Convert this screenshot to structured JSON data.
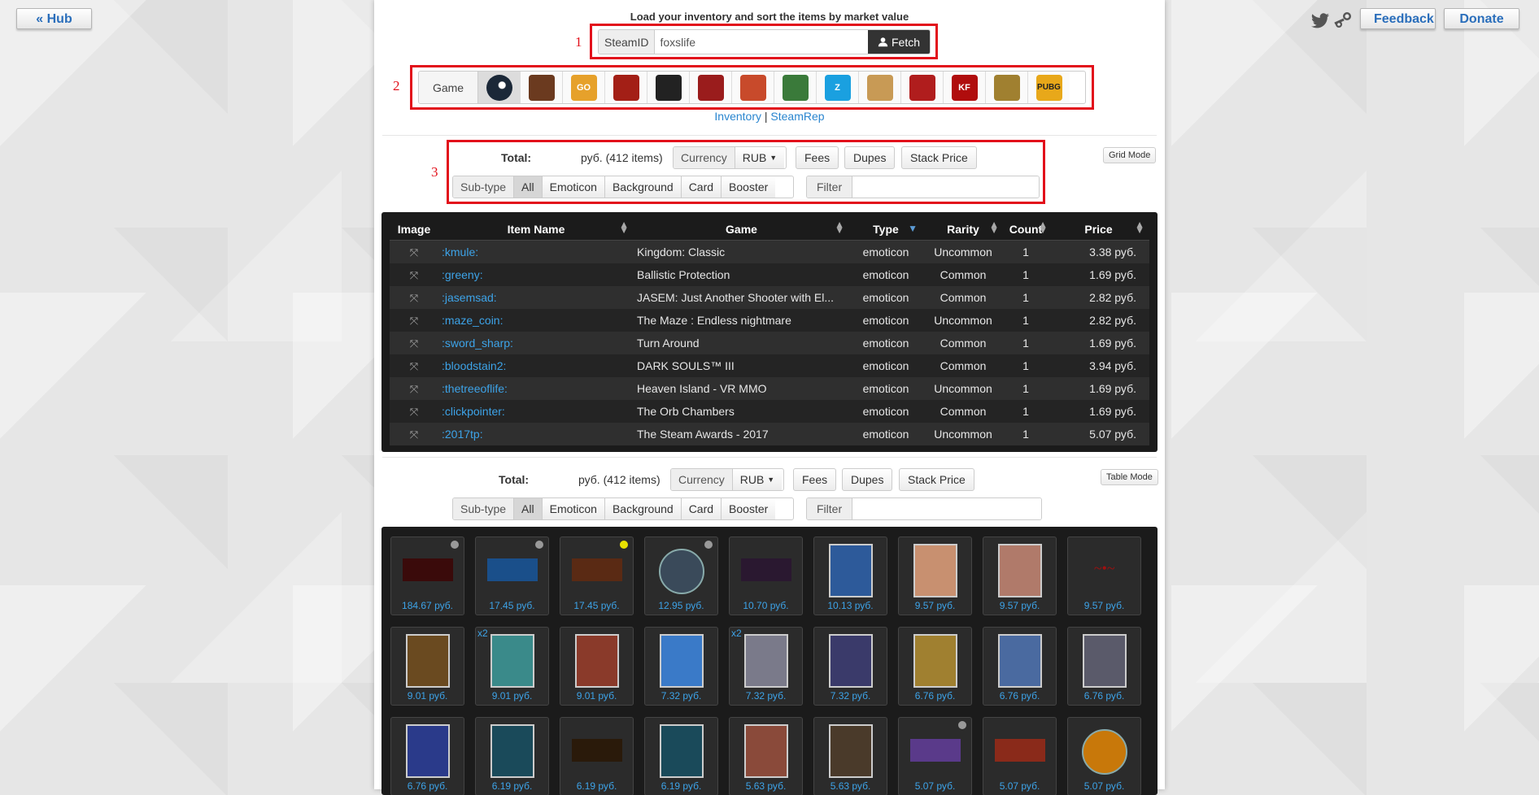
{
  "header": {
    "hub_label": "« Hub",
    "feedback_label": "Feedback",
    "donate_label": "Donate"
  },
  "load": {
    "title": "Load your inventory and sort the items by market value",
    "steamid_label": "SteamID",
    "steamid_value": "foxslife",
    "fetch_label": "Fetch"
  },
  "annotations": [
    "1",
    "2",
    "3"
  ],
  "games": {
    "label": "Game",
    "items": [
      {
        "icon": "steam-icon",
        "color": "#1b2838",
        "text": "",
        "active": true
      },
      {
        "icon": "tf2-icon",
        "color": "#6b3a1f",
        "text": ""
      },
      {
        "icon": "csgo-icon",
        "color": "#e6a12b",
        "text": "GO"
      },
      {
        "icon": "dota2-icon",
        "color": "#a31f16",
        "text": ""
      },
      {
        "icon": "h1z1-icon",
        "color": "#222222",
        "text": ""
      },
      {
        "icon": "payday2-icon",
        "color": "#9a1c1c",
        "text": ""
      },
      {
        "icon": "rust-icon",
        "color": "#c84a2b",
        "text": ""
      },
      {
        "icon": "unturned-icon",
        "color": "#3a7a3a",
        "text": ""
      },
      {
        "icon": "dead-island-icon",
        "color": "#1aa0e0",
        "text": "Z"
      },
      {
        "icon": "bad-rats-icon",
        "color": "#c89a55",
        "text": ""
      },
      {
        "icon": "killing-floor-icon",
        "color": "#b01d1d",
        "text": ""
      },
      {
        "icon": "kf2-icon",
        "color": "#b00d0d",
        "text": "KF"
      },
      {
        "icon": "dota-underlords-icon",
        "color": "#a08030",
        "text": ""
      },
      {
        "icon": "pubg-icon",
        "color": "#e8a81a",
        "text": "PUBG"
      }
    ]
  },
  "links": {
    "inventory": "Inventory",
    "separator": "|",
    "steamrep": "SteamRep"
  },
  "toolbar": {
    "total_label": "Total:",
    "total_value": "руб. (412 items)",
    "currency_label": "Currency",
    "currency_value": "RUB",
    "fees_label": "Fees",
    "dupes_label": "Dupes",
    "stack_price_label": "Stack Price",
    "grid_mode_label": "Grid Mode",
    "table_mode_label": "Table Mode",
    "subtype_label": "Sub-type",
    "subtypes": [
      "All",
      "Emoticon",
      "Background",
      "Card",
      "Booster"
    ],
    "filter_label": "Filter"
  },
  "table": {
    "columns": [
      "Image",
      "Item Name",
      "Game",
      "Type",
      "Rarity",
      "Count",
      "Price"
    ],
    "rows": [
      {
        "name": ":kmule:",
        "game": "Kingdom: Classic",
        "type": "emoticon",
        "rarity": "Uncommon",
        "count": "1",
        "price": "3.38 руб."
      },
      {
        "name": ":greeny:",
        "game": "Ballistic Protection",
        "type": "emoticon",
        "rarity": "Common",
        "count": "1",
        "price": "1.69 руб."
      },
      {
        "name": ":jasemsad:",
        "game": "JASEM: Just Another Shooter with El...",
        "type": "emoticon",
        "rarity": "Common",
        "count": "1",
        "price": "2.82 руб."
      },
      {
        "name": ":maze_coin:",
        "game": "The Maze : Endless nightmare",
        "type": "emoticon",
        "rarity": "Uncommon",
        "count": "1",
        "price": "2.82 руб."
      },
      {
        "name": ":sword_sharp:",
        "game": "Turn Around",
        "type": "emoticon",
        "rarity": "Common",
        "count": "1",
        "price": "1.69 руб."
      },
      {
        "name": ":bloodstain2:",
        "game": "DARK SOULS™ III",
        "type": "emoticon",
        "rarity": "Common",
        "count": "1",
        "price": "3.94 руб."
      },
      {
        "name": ":thetreeoflife:",
        "game": "Heaven Island - VR MMO",
        "type": "emoticon",
        "rarity": "Uncommon",
        "count": "1",
        "price": "1.69 руб."
      },
      {
        "name": ":clickpointer:",
        "game": "The Orb Chambers",
        "type": "emoticon",
        "rarity": "Common",
        "count": "1",
        "price": "1.69 руб."
      },
      {
        "name": ":2017tp:",
        "game": "The Steam Awards - 2017",
        "type": "emoticon",
        "rarity": "Uncommon",
        "count": "1",
        "price": "5.07 руб."
      }
    ]
  },
  "grid": {
    "tiles": [
      {
        "price": "184.67 руб.",
        "kind": "wide",
        "color": "#3a0a0a",
        "dot": "#999999"
      },
      {
        "price": "17.45 руб.",
        "kind": "wide",
        "color": "#1a4f8a",
        "dot": "#999999"
      },
      {
        "price": "17.45 руб.",
        "kind": "wide",
        "color": "#5a2a14",
        "dot": "#e8e000"
      },
      {
        "price": "12.95 руб.",
        "kind": "round",
        "color": "#3a4a5a",
        "dot": "#999999"
      },
      {
        "price": "10.70 руб.",
        "kind": "wide",
        "color": "#2a1830"
      },
      {
        "price": "10.13 руб.",
        "kind": "card",
        "color": "#2d5a9a"
      },
      {
        "price": "9.57 руб.",
        "kind": "card",
        "color": "#c89070"
      },
      {
        "price": "9.57 руб.",
        "kind": "card",
        "color": "#b07a6a"
      },
      {
        "price": "9.57 руб.",
        "kind": "text",
        "color": "#a01010"
      },
      {
        "price": "9.01 руб.",
        "kind": "card",
        "color": "#6a4a20"
      },
      {
        "price": "9.01 руб.",
        "kind": "card",
        "color": "#3a8a8a",
        "count": "x2"
      },
      {
        "price": "9.01 руб.",
        "kind": "card",
        "color": "#8a3a2a"
      },
      {
        "price": "7.32 руб.",
        "kind": "card",
        "color": "#3a7ac8"
      },
      {
        "price": "7.32 руб.",
        "kind": "card",
        "color": "#7a7a8a",
        "count": "x2"
      },
      {
        "price": "7.32 руб.",
        "kind": "card",
        "color": "#3a3a6a"
      },
      {
        "price": "6.76 руб.",
        "kind": "card",
        "color": "#a08030"
      },
      {
        "price": "6.76 руб.",
        "kind": "card",
        "color": "#4a6aa0"
      },
      {
        "price": "6.76 руб.",
        "kind": "card",
        "color": "#5a5a6a"
      },
      {
        "price": "6.76 руб.",
        "kind": "card",
        "color": "#2a3a8a"
      },
      {
        "price": "6.19 руб.",
        "kind": "card",
        "color": "#1a4a5a"
      },
      {
        "price": "6.19 руб.",
        "kind": "wide",
        "color": "#2a1a0a"
      },
      {
        "price": "6.19 руб.",
        "kind": "card",
        "color": "#1a4a5a"
      },
      {
        "price": "5.63 руб.",
        "kind": "card",
        "color": "#8a4a3a"
      },
      {
        "price": "5.63 руб.",
        "kind": "card",
        "color": "#4a3a2a"
      },
      {
        "price": "5.07 руб.",
        "kind": "wide",
        "color": "#5a3a8a",
        "dot": "#999999"
      },
      {
        "price": "5.07 руб.",
        "kind": "wide",
        "color": "#8a2a1a"
      },
      {
        "price": "5.07 руб.",
        "kind": "round",
        "color": "#c8780a"
      }
    ]
  }
}
